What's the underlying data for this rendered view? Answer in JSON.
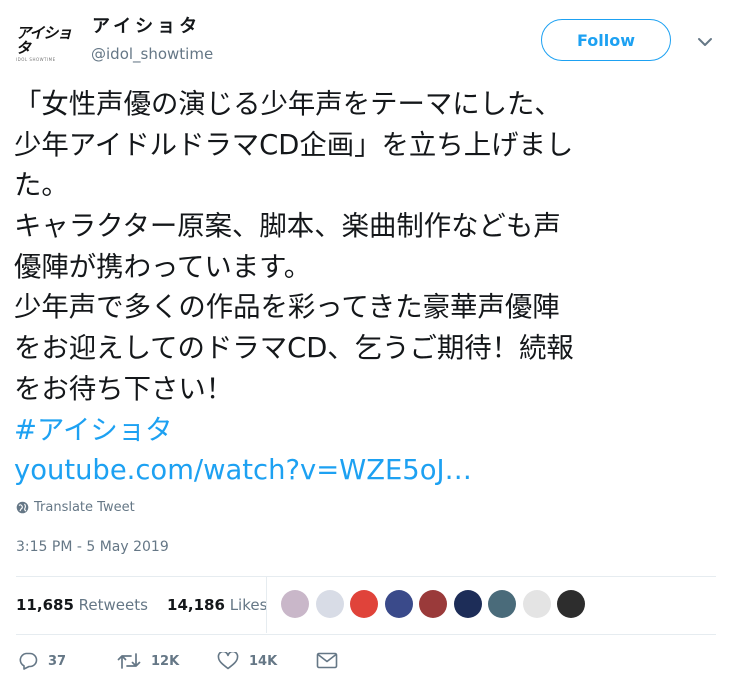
{
  "account": {
    "logo_text": "アイショタ",
    "logo_sub": "IDOL SHOWTIME",
    "name": "アイショタ",
    "handle": "@idol_showtime",
    "follow_label": "Follow"
  },
  "tweet": {
    "lines": [
      "「女性声優の演じる少年声をテーマにした、",
      "少年アイドルドラマCD企画」を立ち上げまし",
      "た。",
      "キャラクター原案、脚本、楽曲制作なども声",
      "優陣が携わっています。",
      "少年声で多くの作品を彩ってきた豪華声優陣",
      "をお迎えしてのドラマCD、乞うご期待！続報",
      "をお待ち下さい！"
    ],
    "hashtag": "#アイショタ",
    "link": "youtube.com/watch?v=WZE5oJ…",
    "translate_label": "Translate Tweet",
    "timestamp": "3:15 PM - 5 May 2019"
  },
  "stats": {
    "retweets_count": "11,685",
    "retweets_label": "Retweets",
    "likes_count": "14,186",
    "likes_label": "Likes"
  },
  "liked_by_avatar_colors": [
    "#c9b7c9",
    "#d8dce6",
    "#e0433a",
    "#3a4a8a",
    "#9a3a3a",
    "#1d2d58",
    "#4a6b7a",
    "#e4e4e4",
    "#2d2d2d"
  ],
  "actions": {
    "replies": "37",
    "retweets": "12K",
    "likes": "14K"
  },
  "colors": {
    "accent": "#1da1f2",
    "text": "#14171a",
    "muted": "#657786",
    "divider": "#e6ecf0"
  }
}
